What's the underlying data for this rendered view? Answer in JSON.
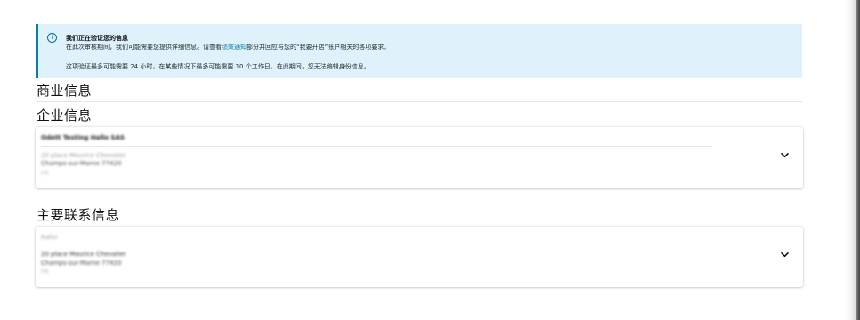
{
  "alert": {
    "icon": "info-icon",
    "title": "我们正在验证您的信息",
    "line1_prefix": "在此次审核期间，我们可能需要您提供详细信息。请查看",
    "line1_link": "绩效通知",
    "line1_suffix": "部分并回应与您的“我要开店”账户相关的各项要求。",
    "line2": "这项验证最多可能需要 24 小时，在某些情况下最多可能需要 10 个工作日。在此期间，您无法编辑身份信息。",
    "accent_color": "#0a7ea8",
    "background_color": "#dff1fb"
  },
  "sections": {
    "business_info_title": "商业信息",
    "enterprise_info_title": "企业信息",
    "primary_contact_title": "主要联系信息"
  },
  "enterprise_card": {
    "company_name": "Odett Testing Hallo SAS",
    "address_line1": "20 place Maurice Chevalier",
    "address_line2": "Champs-sur-Marne 77420",
    "address_line3": "FR",
    "expand_icon": "chevron-down-icon"
  },
  "contact_card": {
    "contact_name": "Kalivi",
    "address_line1": "20 place Maurice Chevalier",
    "address_line2": "Champs-sur-Marne 77420",
    "address_line3": "FR",
    "expand_icon": "chevron-down-icon"
  }
}
